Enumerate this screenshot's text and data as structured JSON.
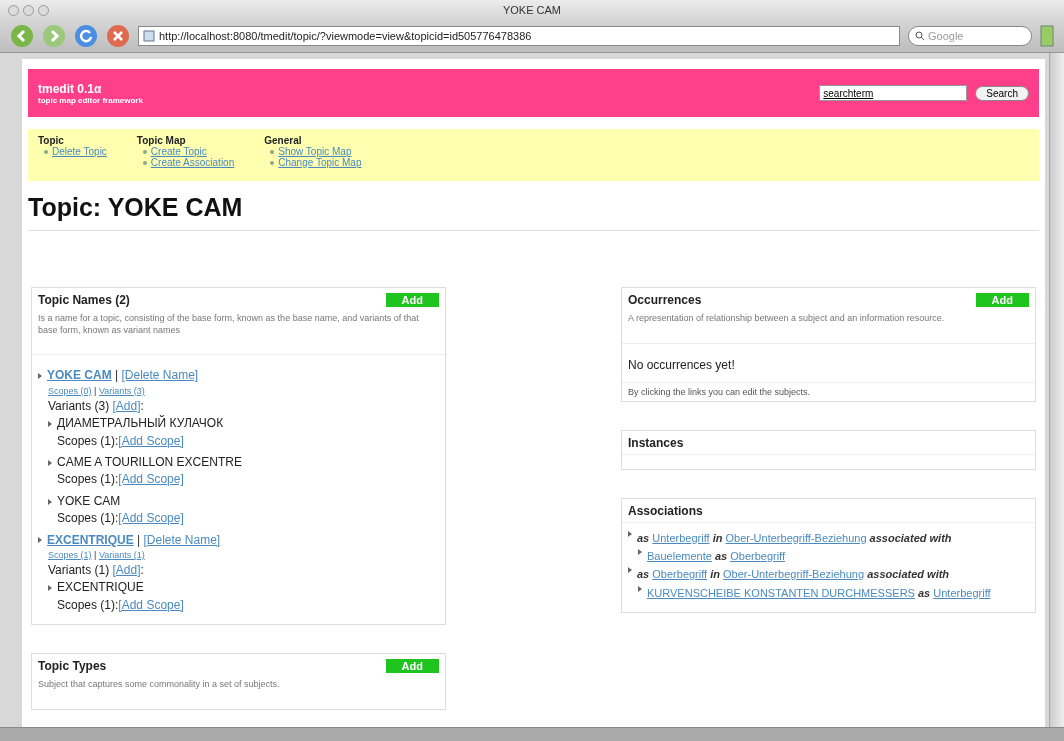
{
  "window": {
    "title": "YOKE CAM"
  },
  "toolbar": {
    "url": "http://localhost:8080/tmedit/topic/?viewmode=view&topicid=id505776478386",
    "search_placeholder": "Google"
  },
  "header": {
    "title": "tmedit 0.1α",
    "subtitle": "topic map editor framework",
    "search_value": "searchterm",
    "search_button": "Search"
  },
  "nav": [
    {
      "heading": "Topic",
      "links": [
        "Delete Topic"
      ]
    },
    {
      "heading": "Topic Map",
      "links": [
        "Create Topic",
        "Create Association"
      ]
    },
    {
      "heading": "General",
      "links": [
        "Show Topic Map",
        "Change Topic Map"
      ]
    }
  ],
  "page_title": "Topic: YOKE CAM",
  "topic_names": {
    "title": "Topic Names (2)",
    "add": "Add",
    "description": "Is a name for a topic, consisting of the base form, known as the base name, and variants of that base form, known as variant names",
    "separator": "|",
    "names": [
      {
        "name": "YOKE CAM",
        "delete": "[Delete Name]",
        "scopes_link": "Scopes (0)",
        "variants_link": "Variants (3)",
        "variants_label": "Variants (3)",
        "variants_add": "[Add]",
        "variants_suffix": ":",
        "variants": [
          {
            "name": "ДИАМЕТРАЛЬНЫЙ КУЛАЧОК",
            "scopes_label": "Scopes (1):",
            "add_scope": "[Add Scope]"
          },
          {
            "name": "CAME A TOURILLON EXCENTRE",
            "scopes_label": "Scopes (1):",
            "add_scope": "[Add Scope]"
          },
          {
            "name": "YOKE CAM",
            "scopes_label": "Scopes (1):",
            "add_scope": "[Add Scope]"
          }
        ]
      },
      {
        "name": "EXCENTRIQUE",
        "delete": "[Delete Name]",
        "scopes_link": "Scopes (1)",
        "variants_link": "Variants (1)",
        "variants_label": "Variants (1)",
        "variants_add": "[Add]",
        "variants_suffix": ":",
        "variants": [
          {
            "name": "EXCENTRIQUE",
            "scopes_label": "Scopes (1):",
            "add_scope": "[Add Scope]"
          }
        ]
      }
    ]
  },
  "topic_types": {
    "title": "Topic Types",
    "add": "Add",
    "description": "Subject that captures some commonality in a set of subjects."
  },
  "occurrences": {
    "title": "Occurrences",
    "add": "Add",
    "description": "A representation of relationship between a subject and an information resource.",
    "empty": "No occurrences yet!",
    "hint": "By clicking the links you can edit the subjects."
  },
  "instances": {
    "title": "Instances"
  },
  "associations": {
    "title": "Associations",
    "items": [
      {
        "as": "as",
        "role": "Unterbegriff",
        "in": "in",
        "type": "Ober-Unterbegriff-Beziehung",
        "suffix": "associated with",
        "players": [
          {
            "player": "Bauelemente",
            "as": "as",
            "role": "Oberbegriff"
          }
        ]
      },
      {
        "as": "as",
        "role": "Oberbegriff",
        "in": "in",
        "type": "Ober-Unterbegriff-Beziehung",
        "suffix": "associated with",
        "players": [
          {
            "player": "KURVENSCHEIBE KONSTANTEN DURCHMESSERS",
            "as": "as",
            "role": "Unterbegriff"
          }
        ]
      }
    ]
  }
}
